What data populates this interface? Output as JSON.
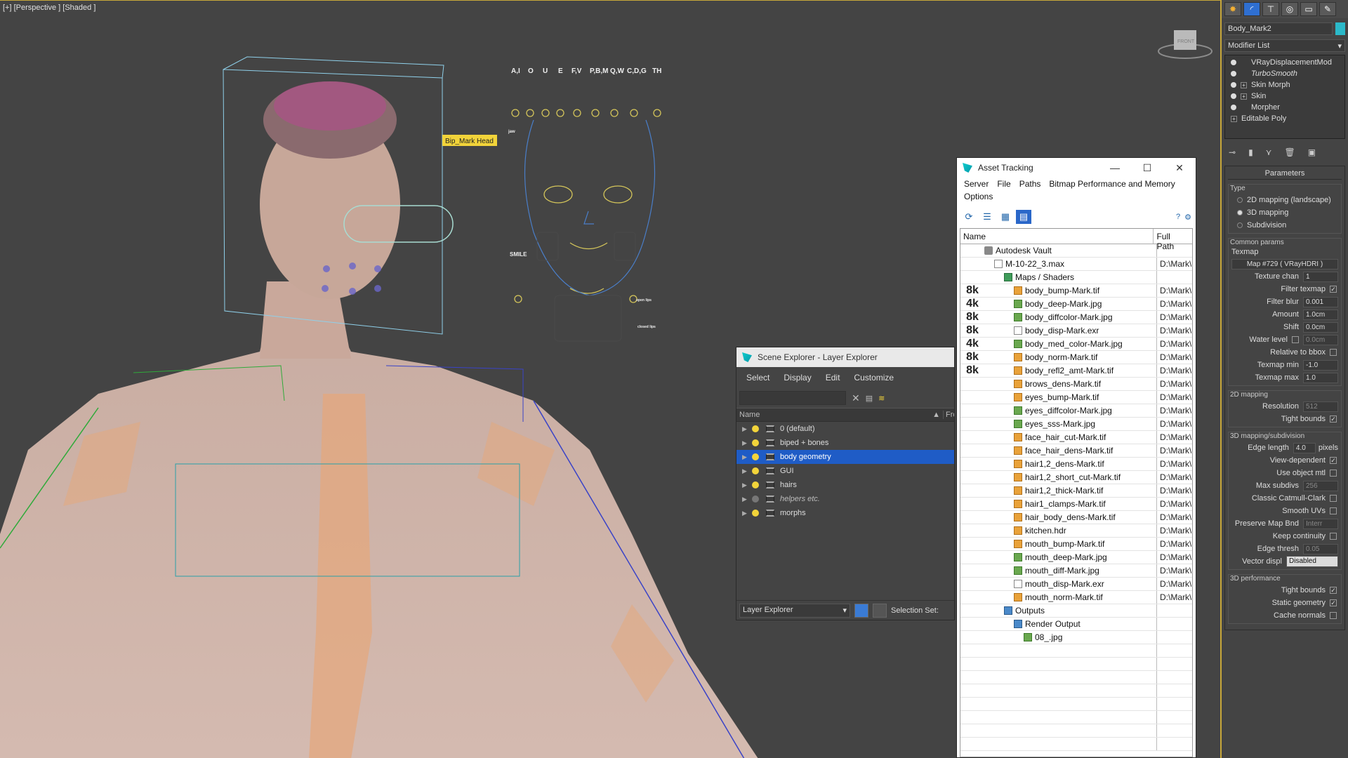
{
  "viewport": {
    "label": "[+] [Perspective ] [Shaded ]",
    "bone_label": "Bip_Mark Head",
    "phonemes": [
      "A,I",
      "O",
      "U",
      "E",
      "F,V",
      "P,B,M",
      "Q,W",
      "C,D,G",
      "TH"
    ],
    "face_labels": {
      "smile": "SMILE",
      "jaw": "jaw",
      "openlips": "open lips",
      "closelips": "closed lips"
    },
    "viewcube_label": "FRONT"
  },
  "scene_explorer": {
    "title": "Scene Explorer - Layer Explorer",
    "menu": [
      "Select",
      "Display",
      "Edit",
      "Customize"
    ],
    "columns": [
      "Name",
      "Fro"
    ],
    "layers": [
      {
        "name": "0 (default)",
        "on": true,
        "selected": false,
        "italic": false
      },
      {
        "name": "biped + bones",
        "on": true,
        "selected": false,
        "italic": false
      },
      {
        "name": "body geometry",
        "on": true,
        "selected": true,
        "italic": false
      },
      {
        "name": "GUI",
        "on": true,
        "selected": false,
        "italic": false
      },
      {
        "name": "hairs",
        "on": true,
        "selected": false,
        "italic": false
      },
      {
        "name": "helpers etc.",
        "on": false,
        "selected": false,
        "italic": true
      },
      {
        "name": "morphs",
        "on": true,
        "selected": false,
        "italic": false
      }
    ],
    "footer_dropdown": "Layer Explorer",
    "selection_set_label": "Selection Set:"
  },
  "asset_tracking": {
    "title": "Asset Tracking",
    "menu": [
      "Server",
      "File",
      "Paths",
      "Bitmap Performance and Memory",
      "Options"
    ],
    "columns": [
      "Name",
      "Full Path"
    ],
    "rows": [
      {
        "res": "",
        "name": "Autodesk Vault",
        "indent": 1,
        "icon": "vault",
        "path": ""
      },
      {
        "res": "",
        "name": "M-10-22_3.max",
        "indent": 2,
        "icon": "file",
        "path": "D:\\Mark\\"
      },
      {
        "res": "",
        "name": "Maps / Shaders",
        "indent": 3,
        "icon": "folder",
        "path": ""
      },
      {
        "res": "8k",
        "name": "body_bump-Mark.tif",
        "indent": 4,
        "icon": "img",
        "path": "D:\\Mark\\"
      },
      {
        "res": "4k",
        "name": "body_deep-Mark.jpg",
        "indent": 4,
        "icon": "jpg",
        "path": "D:\\Mark\\"
      },
      {
        "res": "8k",
        "name": "body_diffcolor-Mark.jpg",
        "indent": 4,
        "icon": "jpg",
        "path": "D:\\Mark\\"
      },
      {
        "res": "8k",
        "name": "body_disp-Mark.exr",
        "indent": 4,
        "icon": "file",
        "path": "D:\\Mark\\"
      },
      {
        "res": "4k",
        "name": "body_med_color-Mark.jpg",
        "indent": 4,
        "icon": "jpg",
        "path": "D:\\Mark\\"
      },
      {
        "res": "8k",
        "name": "body_norm-Mark.tif",
        "indent": 4,
        "icon": "img",
        "path": "D:\\Mark\\"
      },
      {
        "res": "8k",
        "name": "body_refl2_amt-Mark.tif",
        "indent": 4,
        "icon": "img",
        "path": "D:\\Mark\\"
      },
      {
        "res": "",
        "name": "brows_dens-Mark.tif",
        "indent": 4,
        "icon": "img",
        "path": "D:\\Mark\\"
      },
      {
        "res": "",
        "name": "eyes_bump-Mark.tif",
        "indent": 4,
        "icon": "img",
        "path": "D:\\Mark\\"
      },
      {
        "res": "",
        "name": "eyes_diffcolor-Mark.jpg",
        "indent": 4,
        "icon": "jpg",
        "path": "D:\\Mark\\"
      },
      {
        "res": "",
        "name": "eyes_sss-Mark.jpg",
        "indent": 4,
        "icon": "jpg",
        "path": "D:\\Mark\\"
      },
      {
        "res": "",
        "name": "face_hair_cut-Mark.tif",
        "indent": 4,
        "icon": "img",
        "path": "D:\\Mark\\"
      },
      {
        "res": "",
        "name": "face_hair_dens-Mark.tif",
        "indent": 4,
        "icon": "img",
        "path": "D:\\Mark\\"
      },
      {
        "res": "",
        "name": "hair1,2_dens-Mark.tif",
        "indent": 4,
        "icon": "img",
        "path": "D:\\Mark\\"
      },
      {
        "res": "",
        "name": "hair1,2_short_cut-Mark.tif",
        "indent": 4,
        "icon": "img",
        "path": "D:\\Mark\\"
      },
      {
        "res": "",
        "name": "hair1,2_thick-Mark.tif",
        "indent": 4,
        "icon": "img",
        "path": "D:\\Mark\\"
      },
      {
        "res": "",
        "name": "hair1_clamps-Mark.tif",
        "indent": 4,
        "icon": "img",
        "path": "D:\\Mark\\"
      },
      {
        "res": "",
        "name": "hair_body_dens-Mark.tif",
        "indent": 4,
        "icon": "img",
        "path": "D:\\Mark\\"
      },
      {
        "res": "",
        "name": "kitchen.hdr",
        "indent": 4,
        "icon": "img",
        "path": "D:\\Mark\\"
      },
      {
        "res": "",
        "name": "mouth_bump-Mark.tif",
        "indent": 4,
        "icon": "img",
        "path": "D:\\Mark\\"
      },
      {
        "res": "",
        "name": "mouth_deep-Mark.jpg",
        "indent": 4,
        "icon": "jpg",
        "path": "D:\\Mark\\"
      },
      {
        "res": "",
        "name": "mouth_diff-Mark.jpg",
        "indent": 4,
        "icon": "jpg",
        "path": "D:\\Mark\\"
      },
      {
        "res": "",
        "name": "mouth_disp-Mark.exr",
        "indent": 4,
        "icon": "file",
        "path": "D:\\Mark\\"
      },
      {
        "res": "",
        "name": "mouth_norm-Mark.tif",
        "indent": 4,
        "icon": "img",
        "path": "D:\\Mark\\"
      },
      {
        "res": "",
        "name": "Outputs",
        "indent": 3,
        "icon": "out",
        "path": ""
      },
      {
        "res": "",
        "name": "Render Output",
        "indent": 4,
        "icon": "out",
        "path": ""
      },
      {
        "res": "",
        "name": "08_.jpg",
        "indent": 5,
        "icon": "jpg",
        "path": ""
      }
    ]
  },
  "command_panel": {
    "object_name": "Body_Mark2",
    "modifier_list": "Modifier List",
    "stack": [
      {
        "name": "VRayDisplacementMod",
        "plus": false,
        "italic": false
      },
      {
        "name": "TurboSmooth",
        "plus": false,
        "italic": true
      },
      {
        "name": "Skin Morph",
        "plus": true,
        "italic": false
      },
      {
        "name": "Skin",
        "plus": true,
        "italic": false
      },
      {
        "name": "Morpher",
        "plus": false,
        "italic": false
      }
    ],
    "base": "Editable Poly",
    "params_title": "Parameters",
    "type_label": "Type",
    "type_options": [
      "2D mapping (landscape)",
      "3D mapping",
      "Subdivision"
    ],
    "type_selected": 1,
    "common_label": "Common params",
    "texmap_label": "Texmap",
    "texmap_value": "Map #729  ( VRayHDRI )",
    "texture_chan_label": "Texture chan",
    "texture_chan": "1",
    "filter_texmap_label": "Filter texmap",
    "filter_blur_label": "Filter blur",
    "filter_blur": "0.001",
    "amount_label": "Amount",
    "amount": "1.0cm",
    "shift_label": "Shift",
    "shift": "0.0cm",
    "water_level_label": "Water level",
    "water_level": "0.0cm",
    "relative_bbox_label": "Relative to bbox",
    "texmap_min_label": "Texmap min",
    "texmap_min": "-1.0",
    "texmap_max_label": "Texmap max",
    "texmap_max": "1.0",
    "mapping2d_label": "2D mapping",
    "resolution_label": "Resolution",
    "resolution": "512",
    "tight_bounds_label": "Tight bounds",
    "mapping3d_label": "3D mapping/subdivision",
    "edge_length_label": "Edge length",
    "edge_length": "4.0",
    "pixels_label": "pixels",
    "view_dependent_label": "View-dependent",
    "use_object_mtl_label": "Use object mtl",
    "max_subdivs_label": "Max subdivs",
    "max_subdivs": "256",
    "classic_catmull_label": "Classic Catmull-Clark",
    "smooth_uvs_label": "Smooth UVs",
    "preserve_map_bnd_label": "Preserve Map Bnd",
    "preserve_map_bnd": "Interr",
    "keep_continuity_label": "Keep continuity",
    "edge_thresh_label": "Edge thresh",
    "edge_thresh": "0.05",
    "vector_displ_label": "Vector displ",
    "vector_displ": "Disabled",
    "perf_label": "3D performance",
    "perf_tight_label": "Tight bounds",
    "static_geometry_label": "Static geometry",
    "cache_normals_label": "Cache normals"
  }
}
